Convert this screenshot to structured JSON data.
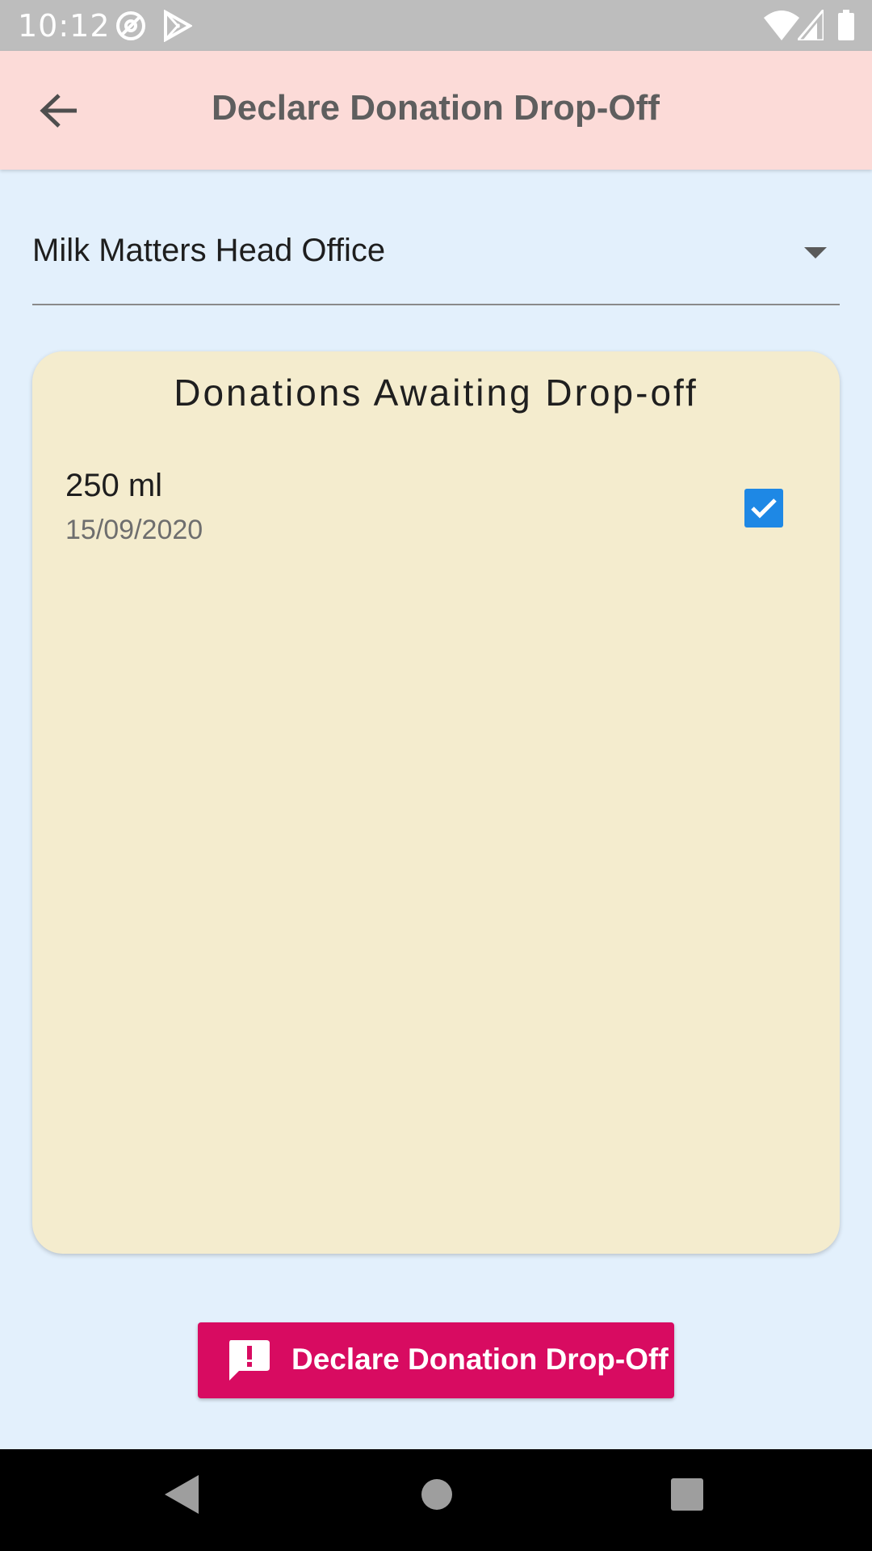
{
  "status_bar": {
    "time": "10:12",
    "icons": [
      "at-sign-icon",
      "play-store-icon",
      "wifi-icon",
      "signal-icon",
      "battery-icon"
    ]
  },
  "app_bar": {
    "title": "Declare Donation Drop-Off",
    "back_icon": "arrow-back-icon",
    "background": "#fcdbd8"
  },
  "location_dropdown": {
    "selected": "Milk Matters Head Office",
    "icon": "arrow-drop-down-icon"
  },
  "donations_card": {
    "title": "Donations Awaiting Drop-off",
    "background": "#f4ecce",
    "items": [
      {
        "amount": "250 ml",
        "date": "15/09/2020",
        "checked": true
      }
    ]
  },
  "declare_button": {
    "label": "Declare Donation Drop-Off",
    "icon": "feedback-exclamation-icon",
    "color": "#d80b61"
  },
  "nav_bar": {
    "icons": [
      "nav-back-icon",
      "nav-home-icon",
      "nav-recents-icon"
    ]
  },
  "colors": {
    "page_background": "#e3f0fc",
    "checkbox": "#1e88e5"
  }
}
